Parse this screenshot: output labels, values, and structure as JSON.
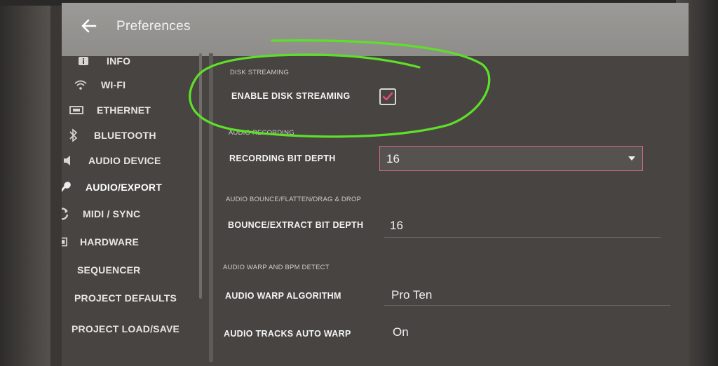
{
  "header": {
    "title": "Preferences",
    "back_icon": "back-arrow-icon"
  },
  "sidebar": {
    "items": [
      {
        "label": "INFO",
        "icon": "info-icon"
      },
      {
        "label": "WI-FI",
        "icon": "wifi-icon"
      },
      {
        "label": "ETHERNET",
        "icon": "ethernet-icon"
      },
      {
        "label": "BLUETOOTH",
        "icon": "bluetooth-icon"
      },
      {
        "label": "AUDIO DEVICE",
        "icon": "speaker-icon"
      },
      {
        "label": "AUDIO/EXPORT",
        "icon": "microphone-icon",
        "active": true
      },
      {
        "label": "MIDI / SYNC",
        "icon": "sync-icon"
      },
      {
        "label": "HARDWARE",
        "icon": "hardware-icon"
      },
      {
        "label": "SEQUENCER",
        "icon": "grid-icon"
      },
      {
        "label": "PROJECT DEFAULTS",
        "icon": "document-icon"
      },
      {
        "label": "PROJECT LOAD/SAVE",
        "icon": "disk-icon"
      }
    ]
  },
  "content": {
    "disk_streaming": {
      "section": "DISK STREAMING",
      "label": "ENABLE DISK STREAMING",
      "checked": true
    },
    "audio_recording": {
      "section": "AUDIO RECORDING",
      "label": "RECORDING BIT DEPTH",
      "value": "16"
    },
    "bounce": {
      "section": "AUDIO BOUNCE/FLATTEN/DRAG & DROP",
      "label": "BOUNCE/EXTRACT BIT DEPTH",
      "value": "16"
    },
    "warp": {
      "section": "AUDIO WARP AND BPM DETECT",
      "algorithm_label": "AUDIO WARP ALGORITHM",
      "algorithm_value": "Pro Ten",
      "autowarp_label": "AUDIO TRACKS AUTO WARP",
      "autowarp_value": "On"
    }
  },
  "colors": {
    "accent": "#e14a7d",
    "annotation": "#5ee02a"
  }
}
